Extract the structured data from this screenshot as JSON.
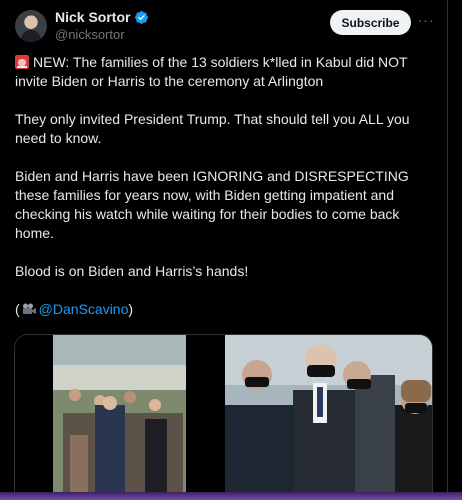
{
  "author": {
    "display_name": "Nick Sortor",
    "handle": "@nicksortor",
    "verified_icon": "verified-badge-icon"
  },
  "actions": {
    "subscribe_label": "Subscribe",
    "more_icon": "more-horizontal-icon"
  },
  "post": {
    "line1_text": "NEW: The families of the 13 soldiers k*lled in Kabul did NOT invite Biden or Harris to the ceremony at Arlington",
    "line2_text": "They only invited President Trump. That should tell you ALL you need to know.",
    "line3_text": "Biden and Harris have been IGNORING and DISRESPECTING these families for years now, with Biden getting impatient and checking his watch while waiting for their bodies to come back home.",
    "line4_text": "Blood is on Biden and Harris’s hands!",
    "credit_open": "(",
    "credit_mention": "@DanScavino",
    "credit_close": ")"
  },
  "colors": {
    "accent": "#1d9bf0",
    "background": "#000000",
    "muted": "#71767b"
  }
}
